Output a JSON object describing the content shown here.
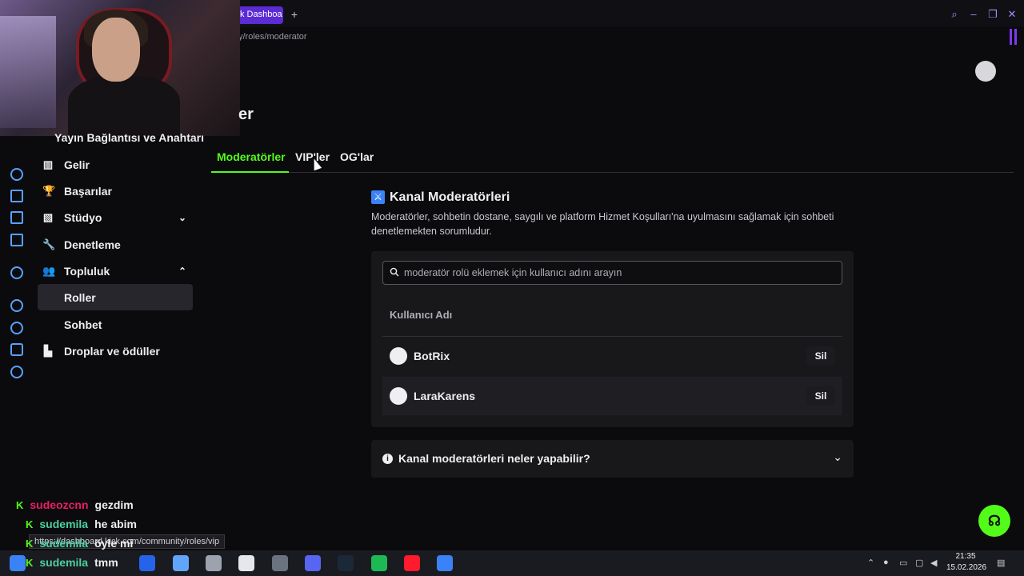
{
  "browser": {
    "tab_title": "k Dashboa",
    "new_tab": "+",
    "address_fragment": "y/roles/moderator",
    "status_url": "https://dashboard.kick.com/community/roles/vip"
  },
  "sidebar": {
    "cut_item": "Yayın Bağlantısı ve Anahtarı",
    "items": [
      {
        "label": "Gelir",
        "icon": "▥"
      },
      {
        "label": "Başarılar",
        "icon": "🏆"
      },
      {
        "label": "Stüdyo",
        "icon": "▧",
        "chevron": "⌄"
      },
      {
        "label": "Denetleme",
        "icon": "🔧"
      },
      {
        "label": "Topluluk",
        "icon": "👥",
        "chevron": "⌃"
      },
      {
        "label": "Roller",
        "icon": ""
      },
      {
        "label": "Sohbet",
        "icon": ""
      },
      {
        "label": "Droplar ve ödüller",
        "icon": "▙"
      }
    ]
  },
  "page": {
    "title_fragment": "er",
    "tabs": [
      "Moderatörler",
      "VIP'ler",
      "OG'lar"
    ],
    "section_title": "Kanal Moderatörleri",
    "section_desc": "Moderatörler, sohbetin dostane, saygılı ve platform Hizmet Koşulları'na uyulmasını sağlamak için sohbeti denetlemekten sorumludur.",
    "search_placeholder": "moderatör rolü eklemek için kullanıcı adını arayın",
    "column_header": "Kullanıcı Adı",
    "moderators": [
      {
        "name": "BotRix",
        "action": "Sil"
      },
      {
        "name": "LaraKarens",
        "action": "Sil"
      }
    ],
    "faq_title": "Kanal moderatörleri neler yapabilir?"
  },
  "chat_overlay": [
    {
      "user": "sudeozcnn",
      "color": "#e91e63",
      "msg": "gezdim"
    },
    {
      "user": "sudemila",
      "color": "#4dd0a0",
      "msg": "he abim"
    },
    {
      "user": "sudemila",
      "color": "#4dd0a0",
      "msg": "öyle mi"
    },
    {
      "user": "sudemila",
      "color": "#4dd0a0",
      "msg": "tmm"
    }
  ],
  "taskbar": {
    "time": "21:35",
    "date": "15.02.2026"
  },
  "colors": {
    "accent": "#53fc18",
    "background": "#0b0b0e",
    "card": "#18181b"
  }
}
